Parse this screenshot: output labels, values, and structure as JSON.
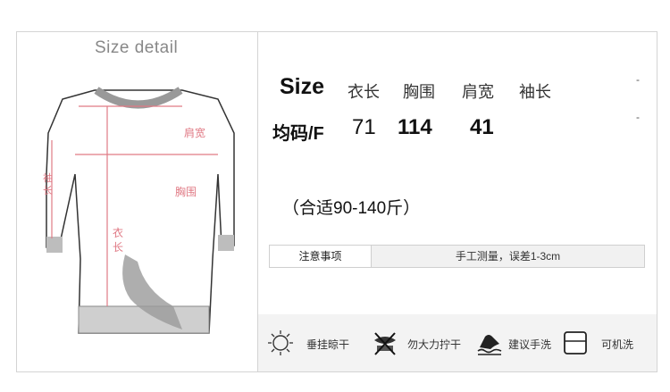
{
  "left": {
    "title": "Size detail"
  },
  "diagram_labels": {
    "shoulder": "肩宽",
    "chest": "胸围",
    "sleeve_char1": "袖",
    "sleeve_char2": "长",
    "length_char1": "衣",
    "length_char2": "长"
  },
  "size_table": {
    "headers": [
      "Size",
      "衣长",
      "胸围",
      "肩宽",
      "袖长"
    ],
    "row": {
      "label": "均码/F",
      "values": [
        "71",
        "114",
        "41"
      ]
    },
    "dashes": [
      "-",
      "-"
    ]
  },
  "fit_note": "（合适90-140斤）",
  "notice": {
    "label": "注意事项",
    "value": "手工测量，误差1-3cm"
  },
  "care": [
    {
      "icon": "sun-icon",
      "label": "垂挂晾干"
    },
    {
      "icon": "no-wring-icon",
      "label": "勿大力拧干"
    },
    {
      "icon": "hand-wash-icon",
      "label": "建议手洗"
    },
    {
      "icon": "machine-wash-icon",
      "label": "可机洗"
    }
  ],
  "colors": {
    "measure_line": "#e07a85",
    "border": "#d4d4d4",
    "care_bg": "#f3f3f3"
  }
}
